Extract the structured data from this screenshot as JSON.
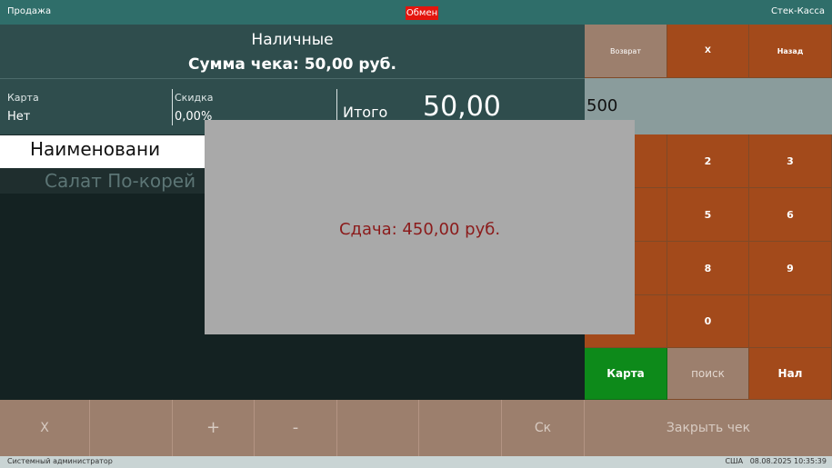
{
  "topbar": {
    "title": "Продажа",
    "exchange": "Обмен",
    "app": "Стек-Касса"
  },
  "header": {
    "payment_type": "Наличные",
    "receipt_sum": "Сумма чека: 50,00 руб."
  },
  "info": {
    "card_label": "Карта",
    "card_value": "Нет",
    "discount_label": "Скидка",
    "discount_value": "0,00%",
    "total_label": "Итого",
    "total_value": "50,00"
  },
  "input": {
    "value": "500"
  },
  "table": {
    "header": "Наименовани",
    "rows": [
      {
        "name": "Салат По-корей"
      }
    ]
  },
  "right_top": {
    "return_label": "Возврат",
    "x_label": "X",
    "back_label": "Назад"
  },
  "keypad": {
    "keys": [
      "2",
      "3",
      "5",
      "6",
      "8",
      "9",
      "0"
    ],
    "card_label": "Карта",
    "search_label": "поиск",
    "cash_label": "Нал"
  },
  "bottom_bar": {
    "x_label": "X",
    "plus_label": "+",
    "minus_label": "-",
    "sk_label": "Ск",
    "close_label": "Закрыть чек"
  },
  "status": {
    "user": "Системный администратор",
    "region_datetime": "США   08.08.2025 10:35:39"
  },
  "modal": {
    "change_text": "Сдача: 450,00 руб."
  },
  "colors": {
    "teal": "#2f6e6a",
    "panel": "#2f4d4d",
    "orange": "#a34a1b",
    "green": "#0d8a1a",
    "tan": "#9c7f6d",
    "red": "#e4150d"
  }
}
